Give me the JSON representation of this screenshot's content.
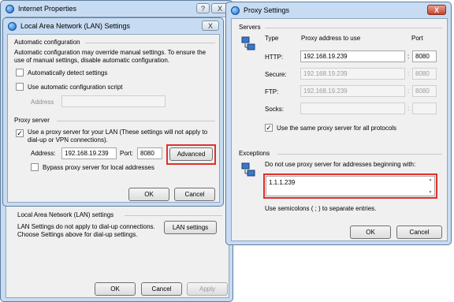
{
  "internet_properties": {
    "title": "Internet Properties",
    "help_label": "?",
    "close_label": "X",
    "lan_section_title": "Local Area Network (LAN) settings",
    "lan_description": "LAN Settings do not apply to dial-up connections. Choose Settings above for dial-up settings.",
    "lan_settings_button": "LAN settings",
    "ok_label": "OK",
    "cancel_label": "Cancel",
    "apply_label": "Apply"
  },
  "lan_dialog": {
    "title": "Local Area Network (LAN) Settings",
    "close_label": "X",
    "auto_config_title": "Automatic configuration",
    "auto_config_desc": "Automatic configuration may override manual settings. To ensure the use of manual settings, disable automatic configuration.",
    "auto_detect_label": "Automatically detect settings",
    "auto_detect_checked": false,
    "auto_script_label": "Use automatic configuration script",
    "auto_script_checked": false,
    "address_label": "Address",
    "address_value": "",
    "proxy_title": "Proxy server",
    "use_proxy_label": "Use a proxy server for your LAN (These settings will not apply to dial-up or VPN connections).",
    "use_proxy_checked": true,
    "proxy_address_label": "Address:",
    "proxy_address_value": "192.168.19.239",
    "port_label": "Port:",
    "port_value": "8080",
    "advanced_button": "Advanced",
    "bypass_label": "Bypass proxy server for local addresses",
    "bypass_checked": false,
    "ok_label": "OK",
    "cancel_label": "Cancel"
  },
  "proxy_dialog": {
    "title": "Proxy Settings",
    "close_label": "X",
    "servers_title": "Servers",
    "type_header": "Type",
    "address_header": "Proxy address to use",
    "port_header": "Port",
    "rows": [
      {
        "label": "HTTP:",
        "address": "192.168.19.239",
        "port": "8080",
        "enabled": true
      },
      {
        "label": "Secure:",
        "address": "192.168.19.239",
        "port": "8080",
        "enabled": false
      },
      {
        "label": "FTP:",
        "address": "192.168.19.239",
        "port": "8080",
        "enabled": false
      },
      {
        "label": "Socks:",
        "address": "",
        "port": "",
        "enabled": false
      }
    ],
    "colon": ":",
    "same_proxy_label": "Use the same proxy server for all protocols",
    "same_proxy_checked": true,
    "exceptions_title": "Exceptions",
    "exceptions_desc": "Do not use proxy server for addresses beginning with:",
    "exceptions_value": "1.1.1.239",
    "semicolon_hint": "Use semicolons ( ; ) to separate entries.",
    "ok_label": "OK",
    "cancel_label": "Cancel"
  },
  "colors": {
    "highlight": "#e0302c",
    "window_frame": "#c7dcf2",
    "client_bg": "#f0f0f0"
  }
}
